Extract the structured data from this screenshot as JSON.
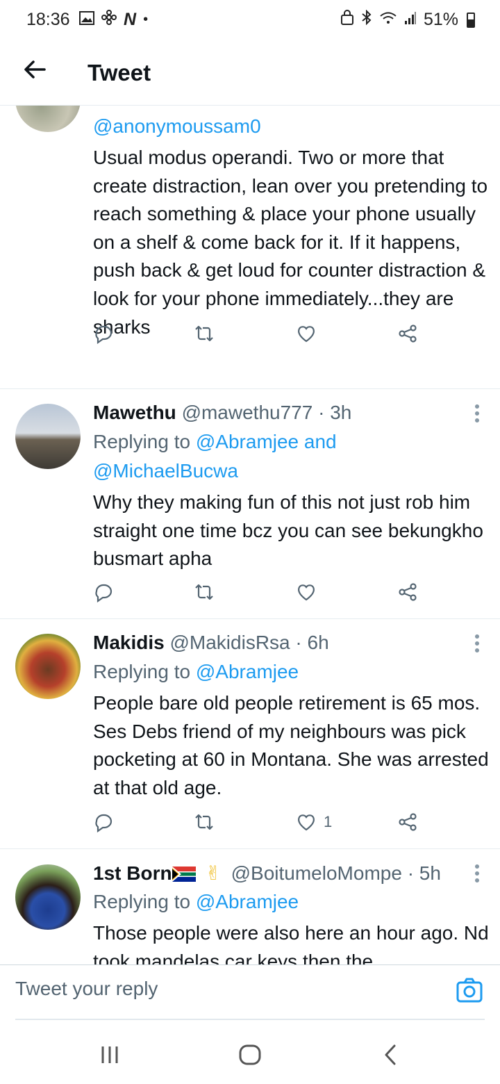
{
  "status_bar": {
    "time": "18:36",
    "battery": "51%"
  },
  "header": {
    "title": "Tweet"
  },
  "tweets": [
    {
      "handle_line": "@anonymoussam0",
      "body": "Usual modus operandi. Two or more that create distraction, lean over you pretending to reach something & place your phone usually on a shelf & come back for it. If it happens, push back & get loud for counter distraction & look for your phone immediately...they are sharks"
    },
    {
      "name": "Mawethu",
      "handle": "@mawethu777 · 3h",
      "replying_prefix": "Replying to",
      "replying_to": "@Abramjee and",
      "replying_to_2": "@MichaelBucwa",
      "body": "Why they making fun of this not just rob him straight one time bcz you can see bekungkho busmart apha"
    },
    {
      "name": "Makidis",
      "handle": "@MakidisRsa · 6h",
      "replying_prefix": "Replying to",
      "replying_to": "@Abramjee",
      "body": "People bare old people retirement is 65 mos. Ses Debs  friend of my neighbours was pick pocketing at 60 in Montana. She was arrested at that old age.",
      "likes": "1"
    },
    {
      "name": "1st Born",
      "name_emoji": "✌",
      "handle": "@BoitumeloMompe · 5h",
      "replying_prefix": "Replying to",
      "replying_to": "@Abramjee",
      "body": "Those people were also here an hour ago. Nd took mandelas car keys then the"
    }
  ],
  "reply_bar": {
    "placeholder": "Tweet your reply"
  },
  "icons": [
    "back-arrow-icon",
    "reply-icon",
    "retweet-icon",
    "like-icon",
    "share-icon",
    "more-icon",
    "camera-icon",
    "recent-apps-icon",
    "home-icon",
    "nav-back-icon"
  ],
  "colors": {
    "link": "#1d9bf0",
    "secondary": "#536471",
    "text": "#0f1419"
  }
}
